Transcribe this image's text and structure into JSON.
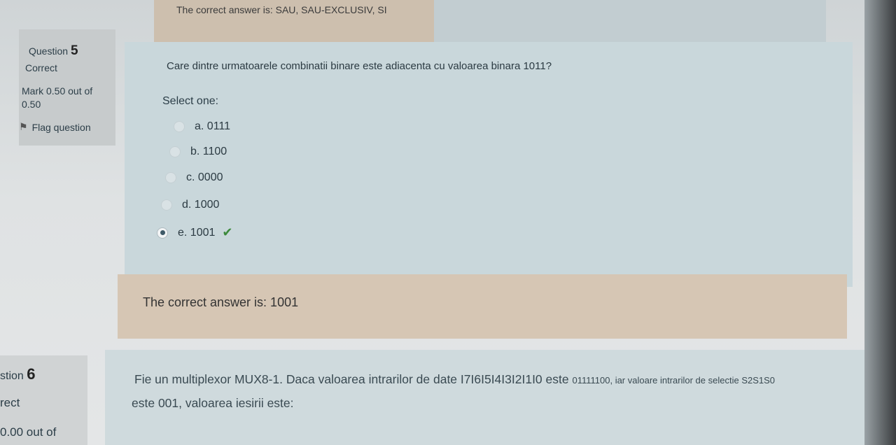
{
  "previous": {
    "feedback": "The correct answer is: SAU, SAU-EXCLUSIV, SI"
  },
  "q5": {
    "info": {
      "question_word": "Question",
      "number": "5",
      "state": "Correct",
      "mark_line1": "Mark 0.50 out of",
      "mark_line2": "0.50",
      "flag_label": "Flag question"
    },
    "text": "Care dintre urmatoarele combinatii binare este adiacenta cu valoarea binara 1011?",
    "prompt": "Select one:",
    "options": [
      {
        "label": "a. 0111",
        "checked": false
      },
      {
        "label": "b. 1100",
        "checked": false
      },
      {
        "label": "c. 0000",
        "checked": false
      },
      {
        "label": "d. 1000",
        "checked": false
      },
      {
        "label": "e. 1001",
        "checked": true,
        "correct_mark": "check-icon"
      }
    ],
    "feedback": "The correct answer is: 1001"
  },
  "q6": {
    "info": {
      "question_partial": "stion",
      "number": "6",
      "state_partial": "rect",
      "mark_partial": "0.00 out of"
    },
    "text_line1_start": "Fie un multiplexor MUX8-1. Daca valoarea intrarilor de date I7I6I5I4I3I2I1I0 este",
    "text_line1_end": "01111100, iar valoare intrarilor de selectie S2S1S0",
    "text_line2": "este 001, valoarea iesirii este:"
  },
  "colors": {
    "correct_check": "#3c8a3c",
    "feedback_bg": "#d6c6b4",
    "formulation_bg": "#c9d7db"
  }
}
